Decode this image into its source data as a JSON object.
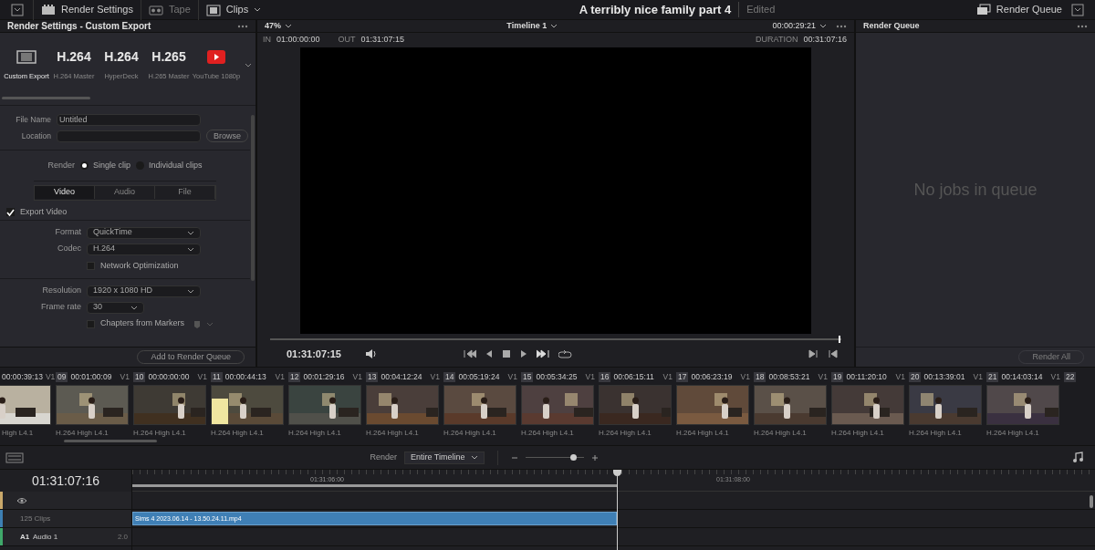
{
  "topbar": {
    "workspaces": [
      {
        "label": "Render Settings",
        "enabled": true
      },
      {
        "label": "Tape",
        "enabled": false
      },
      {
        "label": "Clips",
        "enabled": true
      }
    ],
    "title": "A terribly nice family part 4",
    "status": "Edited",
    "render_queue_button": "Render Queue"
  },
  "render_settings": {
    "title": "Render Settings - Custom Export",
    "presets": [
      {
        "kind": "film",
        "caption": "Custom Export",
        "selected": true
      },
      {
        "kind": "text",
        "label": "H.264",
        "caption": "H.264 Master",
        "selected": false
      },
      {
        "kind": "text",
        "label": "H.264",
        "caption": "HyperDeck",
        "selected": false
      },
      {
        "kind": "text",
        "label": "H.265",
        "caption": "H.265 Master",
        "selected": false
      },
      {
        "kind": "play",
        "caption": "YouTube 1080p",
        "selected": false
      }
    ],
    "file_name_label": "File Name",
    "file_name": "Untitled",
    "location_label": "Location",
    "browse": "Browse",
    "render_label": "Render",
    "render_options": [
      {
        "label": "Single clip",
        "selected": true
      },
      {
        "label": "Individual clips",
        "selected": false
      }
    ],
    "tabs": [
      {
        "label": "Video",
        "selected": true
      },
      {
        "label": "Audio",
        "selected": false
      },
      {
        "label": "File",
        "selected": false
      }
    ],
    "export_video": {
      "label": "Export Video",
      "checked": true
    },
    "format_label": "Format",
    "format": "QuickTime",
    "codec_label": "Codec",
    "codec": "H.264",
    "network_optimization": {
      "label": "Network Optimization",
      "checked": false
    },
    "resolution_label": "Resolution",
    "resolution": "1920 x 1080 HD",
    "frame_rate_label": "Frame rate",
    "frame_rate": "30",
    "chapters": {
      "label": "Chapters from Markers",
      "checked": false
    },
    "add_button": "Add to Render Queue"
  },
  "viewer": {
    "zoom": "47%",
    "timeline_name": "Timeline 1",
    "timecode": "00:00:29:21",
    "in_label": "IN",
    "in": "01:00:00:00",
    "out_label": "OUT",
    "out": "01:31:07:15",
    "duration_label": "DURATION",
    "duration": "00:31:07:16",
    "scrubber": {
      "level": 0.995
    },
    "playhead_timecode": "01:31:07:15"
  },
  "render_queue": {
    "title": "Render Queue",
    "empty_message": "No jobs in queue",
    "render_all": {
      "label": "Render All",
      "disabled": true
    }
  },
  "clips": [
    {
      "timecode": "00:00:39:13",
      "track": "V1",
      "codec": "High L4.1"
    },
    {
      "number": "09",
      "timecode": "00:01:00:09",
      "track": "V1",
      "codec": "H.264 High L4.1"
    },
    {
      "number": "10",
      "timecode": "00:00:00:00",
      "track": "V1",
      "codec": "H.264 High L4.1"
    },
    {
      "number": "11",
      "timecode": "00:00:44:13",
      "track": "V1",
      "codec": "H.264 High L4.1"
    },
    {
      "number": "12",
      "timecode": "00:01:29:16",
      "track": "V1",
      "codec": "H.264 High L4.1"
    },
    {
      "number": "13",
      "timecode": "00:04:12:24",
      "track": "V1",
      "codec": "H.264 High L4.1"
    },
    {
      "number": "14",
      "timecode": "00:05:19:24",
      "track": "V1",
      "codec": "H.264 High L4.1"
    },
    {
      "number": "15",
      "timecode": "00:05:34:25",
      "track": "V1",
      "codec": "H.264 High L4.1"
    },
    {
      "number": "16",
      "timecode": "00:06:15:11",
      "track": "V1",
      "codec": "H.264 High L4.1"
    },
    {
      "number": "17",
      "timecode": "00:06:23:19",
      "track": "V1",
      "codec": "H.264 High L4.1"
    },
    {
      "number": "18",
      "timecode": "00:08:53:21",
      "track": "V1",
      "codec": "H.264 High L4.1"
    },
    {
      "number": "19",
      "timecode": "00:11:20:10",
      "track": "V1",
      "codec": "H.264 High L4.1"
    },
    {
      "number": "20",
      "timecode": "00:13:39:01",
      "track": "V1",
      "codec": "H.264 High L4.1"
    },
    {
      "number": "21",
      "timecode": "00:14:03:14",
      "track": "V1",
      "codec": "H.264 High L4.1"
    },
    {
      "number": "22"
    }
  ],
  "timeline": {
    "render_label": "Render",
    "render_mode": "Entire Timeline",
    "zoom": {
      "level": 0.82
    },
    "timecode": "01:31:07:16",
    "ruler_labels": [
      "01:31:06:00",
      "01:31:08:00"
    ],
    "tracks": [
      {
        "kind": "video",
        "color": "#c9a86a"
      },
      {
        "kind": "video",
        "label": "125 Clips",
        "color": "#3d7fb3",
        "clip": "Sims 4 2023.06.14 - 13.50.24.11.mp4"
      },
      {
        "kind": "audio",
        "id": "A1",
        "label": "Audio 1",
        "channels": "2.0",
        "color": "#3fa86a"
      }
    ]
  }
}
